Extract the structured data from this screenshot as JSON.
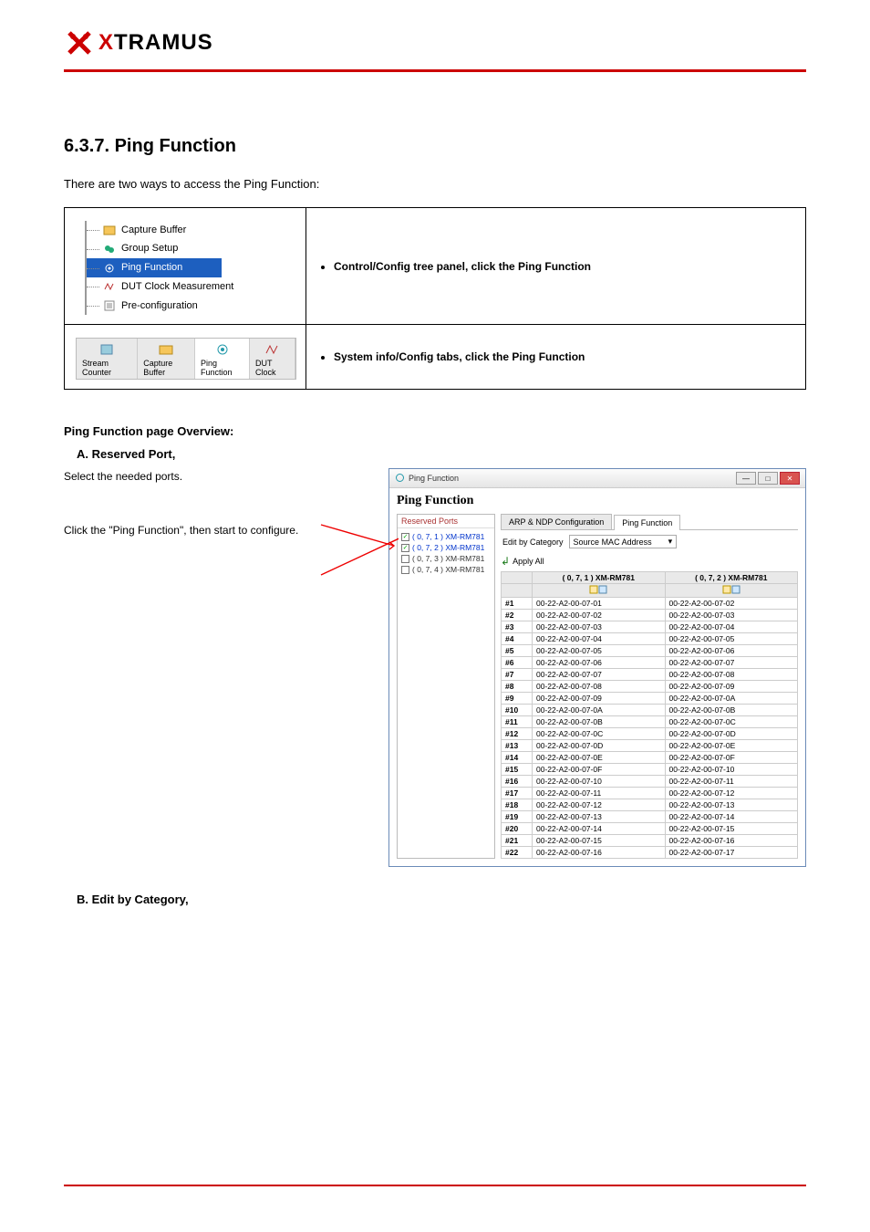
{
  "logo_text_black": "TRAMUS",
  "logo_text_red": "X",
  "section_title": "6.3.7. Ping Function",
  "intro": "There are two ways to access the Ping Function:",
  "access_rows": [
    {
      "left_tree": [
        "Capture Buffer",
        "Group Setup",
        "Ping Function",
        "DUT Clock Measurement",
        "Pre-configuration"
      ],
      "selected_index": 2,
      "bullet": "Control/Config tree panel, click the Ping Function"
    },
    {
      "tabs": [
        "Stream Counter",
        "Capture Buffer",
        "Ping Function",
        "DUT Clock"
      ],
      "active_index": 2,
      "bullet": "System info/Config tabs, click the Ping Function"
    }
  ],
  "window": {
    "title": "Ping Function",
    "heading": "Ping Function",
    "reserved_label": "Reserved Ports",
    "ports": [
      {
        "label": "( 0, 7, 1 ) XM-RM781",
        "checked": true
      },
      {
        "label": "( 0, 7, 2 ) XM-RM781",
        "checked": true
      },
      {
        "label": "( 0, 7, 3 ) XM-RM781",
        "checked": false
      },
      {
        "label": "( 0, 7, 4 ) XM-RM781",
        "checked": false
      }
    ],
    "tabs": [
      "ARP & NDP Configuration",
      "Ping Function"
    ],
    "active_tab": 1,
    "edit_label": "Edit by Category",
    "select_value": "Source MAC Address",
    "apply_label": "Apply All",
    "col1": "( 0, 7, 1 ) XM-RM781",
    "col2": "( 0, 7, 2 ) XM-RM781",
    "rows": [
      {
        "n": "#1",
        "a": "00-22-A2-00-07-01",
        "b": "00-22-A2-00-07-02"
      },
      {
        "n": "#2",
        "a": "00-22-A2-00-07-02",
        "b": "00-22-A2-00-07-03"
      },
      {
        "n": "#3",
        "a": "00-22-A2-00-07-03",
        "b": "00-22-A2-00-07-04"
      },
      {
        "n": "#4",
        "a": "00-22-A2-00-07-04",
        "b": "00-22-A2-00-07-05"
      },
      {
        "n": "#5",
        "a": "00-22-A2-00-07-05",
        "b": "00-22-A2-00-07-06"
      },
      {
        "n": "#6",
        "a": "00-22-A2-00-07-06",
        "b": "00-22-A2-00-07-07"
      },
      {
        "n": "#7",
        "a": "00-22-A2-00-07-07",
        "b": "00-22-A2-00-07-08"
      },
      {
        "n": "#8",
        "a": "00-22-A2-00-07-08",
        "b": "00-22-A2-00-07-09"
      },
      {
        "n": "#9",
        "a": "00-22-A2-00-07-09",
        "b": "00-22-A2-00-07-0A"
      },
      {
        "n": "#10",
        "a": "00-22-A2-00-07-0A",
        "b": "00-22-A2-00-07-0B"
      },
      {
        "n": "#11",
        "a": "00-22-A2-00-07-0B",
        "b": "00-22-A2-00-07-0C"
      },
      {
        "n": "#12",
        "a": "00-22-A2-00-07-0C",
        "b": "00-22-A2-00-07-0D"
      },
      {
        "n": "#13",
        "a": "00-22-A2-00-07-0D",
        "b": "00-22-A2-00-07-0E"
      },
      {
        "n": "#14",
        "a": "00-22-A2-00-07-0E",
        "b": "00-22-A2-00-07-0F"
      },
      {
        "n": "#15",
        "a": "00-22-A2-00-07-0F",
        "b": "00-22-A2-00-07-10"
      },
      {
        "n": "#16",
        "a": "00-22-A2-00-07-10",
        "b": "00-22-A2-00-07-11"
      },
      {
        "n": "#17",
        "a": "00-22-A2-00-07-11",
        "b": "00-22-A2-00-07-12"
      },
      {
        "n": "#18",
        "a": "00-22-A2-00-07-12",
        "b": "00-22-A2-00-07-13"
      },
      {
        "n": "#19",
        "a": "00-22-A2-00-07-13",
        "b": "00-22-A2-00-07-14"
      },
      {
        "n": "#20",
        "a": "00-22-A2-00-07-14",
        "b": "00-22-A2-00-07-15"
      },
      {
        "n": "#21",
        "a": "00-22-A2-00-07-15",
        "b": "00-22-A2-00-07-16"
      },
      {
        "n": "#22",
        "a": "00-22-A2-00-07-16",
        "b": "00-22-A2-00-07-17"
      }
    ]
  },
  "overview_label": "Ping Function page Overview:",
  "a_item": "A. Reserved Port,",
  "para_a1": "Select the needed ports.",
  "para_a2": "Click the \"Ping Function\", then start to configure.",
  "b_item": "B. Edit by Category,"
}
